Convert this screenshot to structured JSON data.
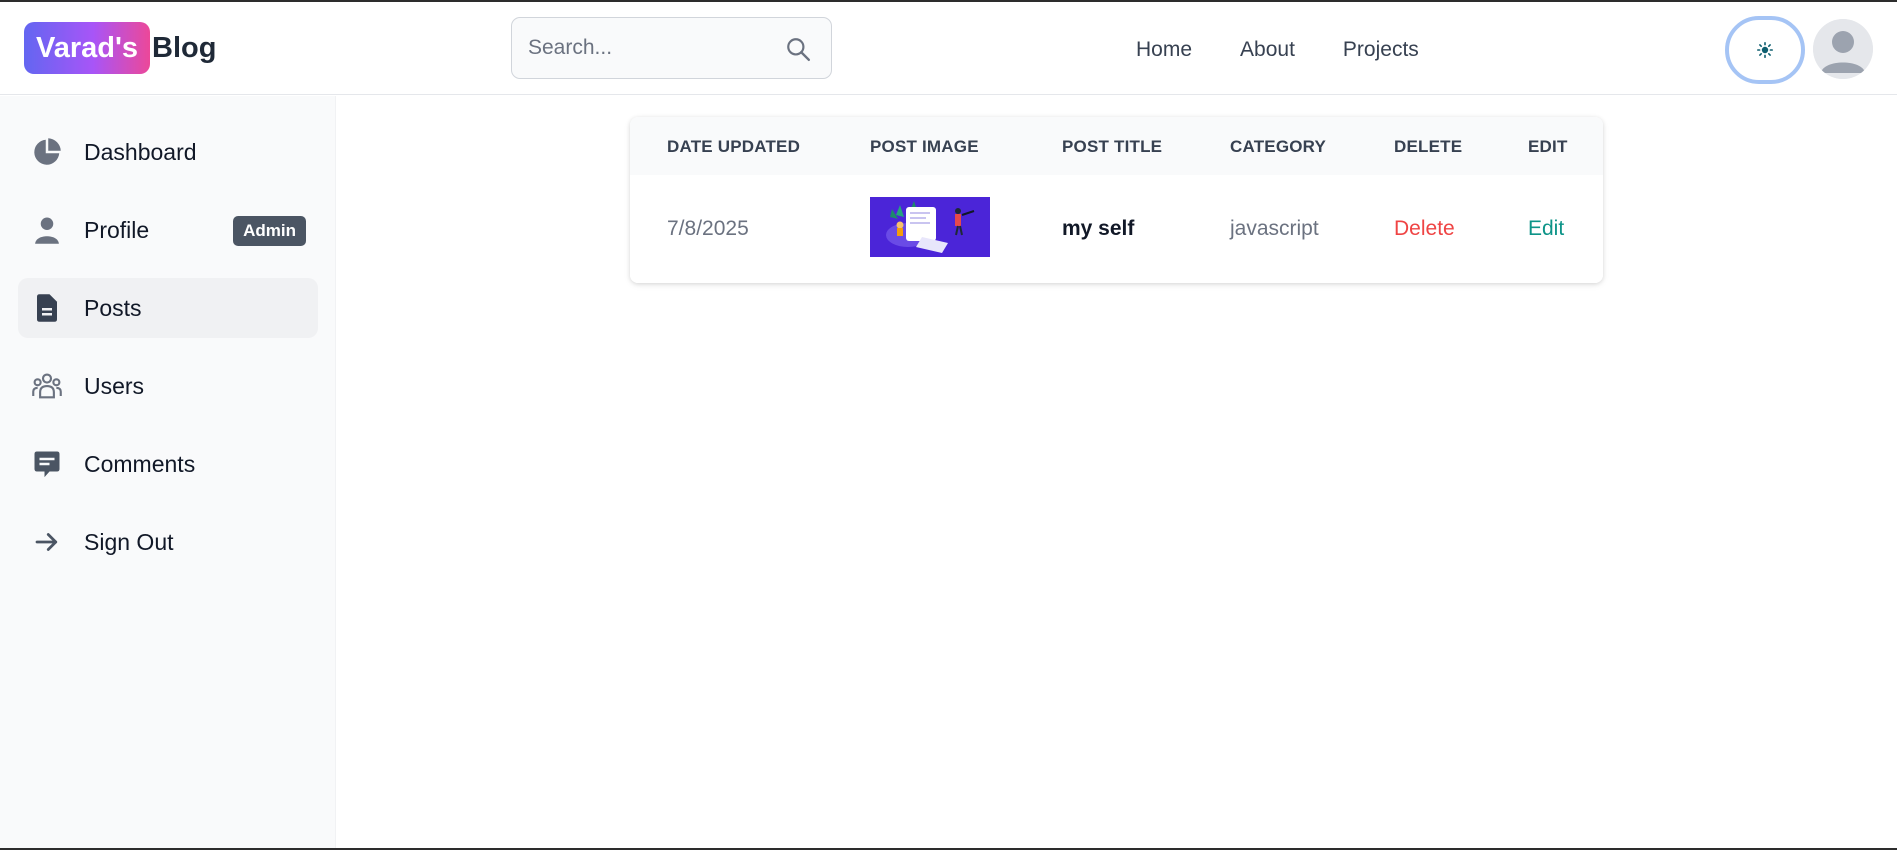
{
  "header": {
    "logo_highlight": "Varad's",
    "logo_rest": "Blog",
    "search_placeholder": "Search...",
    "nav": [
      "Home",
      "About",
      "Projects"
    ],
    "theme_icon": "sun-icon",
    "avatar_icon": "user-avatar-icon"
  },
  "sidebar": {
    "items": [
      {
        "label": "Dashboard",
        "icon": "pie-chart-icon",
        "active": false
      },
      {
        "label": "Profile",
        "icon": "user-icon",
        "badge": "Admin",
        "active": false
      },
      {
        "label": "Posts",
        "icon": "document-icon",
        "active": true
      },
      {
        "label": "Users",
        "icon": "users-group-icon",
        "active": false
      },
      {
        "label": "Comments",
        "icon": "comment-icon",
        "active": false
      },
      {
        "label": "Sign Out",
        "icon": "arrow-right-icon",
        "active": false
      }
    ]
  },
  "table": {
    "headers": [
      "DATE UPDATED",
      "POST IMAGE",
      "POST TITLE",
      "CATEGORY",
      "DELETE",
      "EDIT"
    ],
    "rows": [
      {
        "date": "7/8/2025",
        "image": "post-thumbnail",
        "title": "my self",
        "category": "javascript",
        "delete": "Delete",
        "edit": "Edit"
      }
    ]
  },
  "colors": {
    "logo_gradient_start": "#6366f1",
    "logo_gradient_end": "#ec4899",
    "delete": "#ef4444",
    "edit": "#0d9488",
    "badge_bg": "#4b5563",
    "thumbnail_bg": "#4b25d8"
  }
}
